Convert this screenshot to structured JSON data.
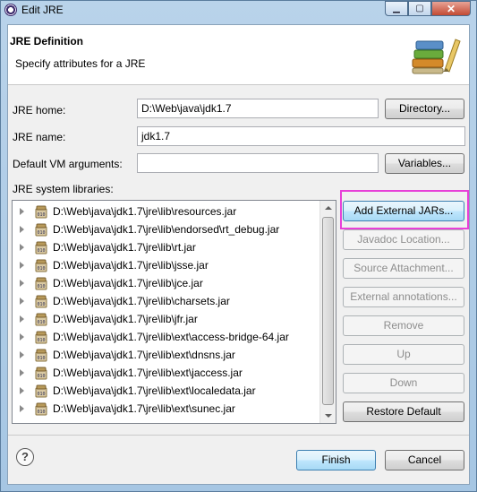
{
  "window": {
    "title": "Edit JRE"
  },
  "header": {
    "title": "JRE Definition",
    "description": "Specify attributes for a JRE"
  },
  "form": {
    "jre_home_label": "JRE home:",
    "jre_home_value": "D:\\Web\\java\\jdk1.7",
    "jre_name_label": "JRE name:",
    "jre_name_value": "jdk1.7",
    "vm_args_label": "Default VM arguments:",
    "vm_args_value": "",
    "libraries_label": "JRE system libraries:"
  },
  "buttons": {
    "directory": "Directory...",
    "variables": "Variables...",
    "add_external_jars": "Add External JARs...",
    "javadoc_location": "Javadoc Location...",
    "source_attachment": "Source Attachment...",
    "external_annotations": "External annotations...",
    "remove": "Remove",
    "up": "Up",
    "down": "Down",
    "restore_default": "Restore Default",
    "finish": "Finish",
    "cancel": "Cancel"
  },
  "libraries": [
    "D:\\Web\\java\\jdk1.7\\jre\\lib\\resources.jar",
    "D:\\Web\\java\\jdk1.7\\jre\\lib\\endorsed\\rt_debug.jar",
    "D:\\Web\\java\\jdk1.7\\jre\\lib\\rt.jar",
    "D:\\Web\\java\\jdk1.7\\jre\\lib\\jsse.jar",
    "D:\\Web\\java\\jdk1.7\\jre\\lib\\jce.jar",
    "D:\\Web\\java\\jdk1.7\\jre\\lib\\charsets.jar",
    "D:\\Web\\java\\jdk1.7\\jre\\lib\\jfr.jar",
    "D:\\Web\\java\\jdk1.7\\jre\\lib\\ext\\access-bridge-64.jar",
    "D:\\Web\\java\\jdk1.7\\jre\\lib\\ext\\dnsns.jar",
    "D:\\Web\\java\\jdk1.7\\jre\\lib\\ext\\jaccess.jar",
    "D:\\Web\\java\\jdk1.7\\jre\\lib\\ext\\localedata.jar",
    "D:\\Web\\java\\jdk1.7\\jre\\lib\\ext\\sunec.jar"
  ],
  "icons": {
    "app": "eclipse-icon",
    "header_image": "jre-books-icon",
    "library": "jar-file-icon",
    "help": "help-icon"
  },
  "colors": {
    "highlight": "#e840d8",
    "titlebar": "#b9d3ea",
    "focused_button": "#3c7fb1"
  }
}
